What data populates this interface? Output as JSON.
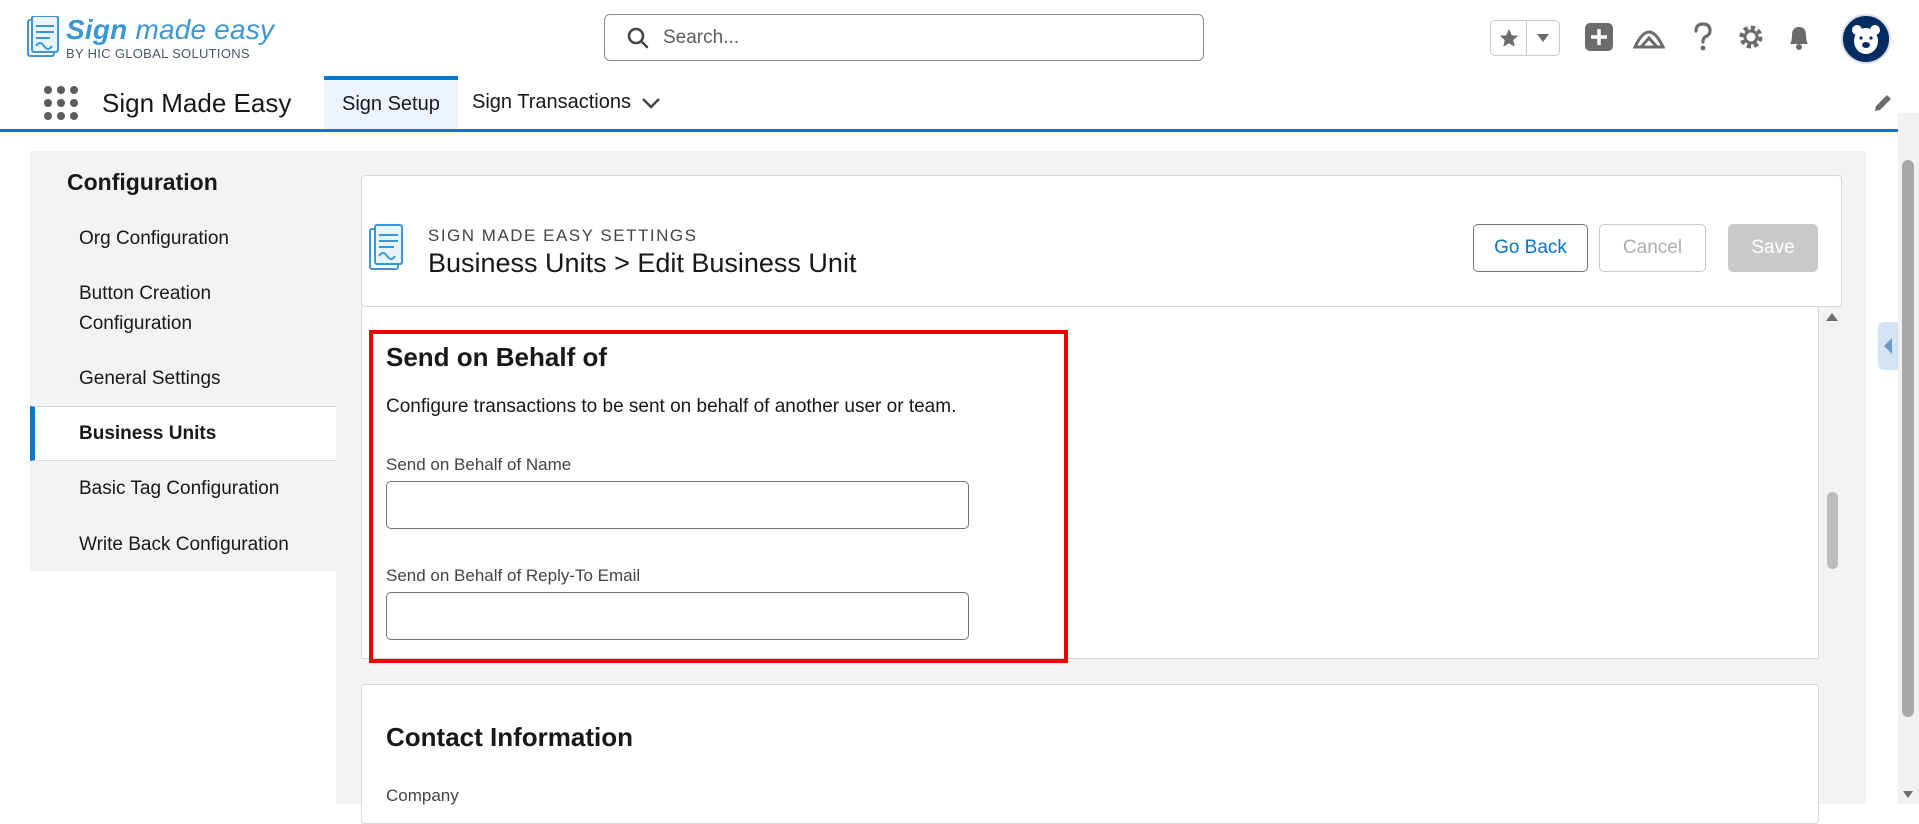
{
  "header": {
    "logo_main_bold": "Sign",
    "logo_main_light": " made easy",
    "logo_sub": "BY HIC GLOBAL SOLUTIONS",
    "search_placeholder": "Search..."
  },
  "app_nav": {
    "app_name": "Sign Made Easy",
    "tabs": [
      {
        "label": "Sign Setup",
        "active": true
      },
      {
        "label": "Sign Transactions",
        "active": false
      }
    ]
  },
  "sidebar": {
    "title": "Configuration",
    "items": [
      {
        "label": "Org Configuration",
        "active": false
      },
      {
        "label": "Button Creation\nConfiguration",
        "active": false
      },
      {
        "label": "General Settings",
        "active": false
      },
      {
        "label": "Business Units",
        "active": true
      },
      {
        "label": "Basic Tag Configuration",
        "active": false
      },
      {
        "label": "Write Back Configuration",
        "active": false
      }
    ]
  },
  "page_header": {
    "eyebrow": "SIGN MADE EASY SETTINGS",
    "title": "Business Units > Edit Business Unit",
    "go_back_label": "Go Back",
    "cancel_label": "Cancel",
    "save_label": "Save"
  },
  "send_on_behalf": {
    "title": "Send on Behalf of",
    "description": "Configure transactions to be sent on behalf of another user or team.",
    "name_label": "Send on Behalf of Name",
    "name_value": "",
    "email_label": "Send on Behalf of Reply-To Email",
    "email_value": ""
  },
  "contact": {
    "title": "Contact Information",
    "company_label": "Company"
  },
  "colors": {
    "brand_blue": "#0176d3",
    "highlight_red": "#ee0000",
    "logo_blue": "#3a97d4"
  }
}
